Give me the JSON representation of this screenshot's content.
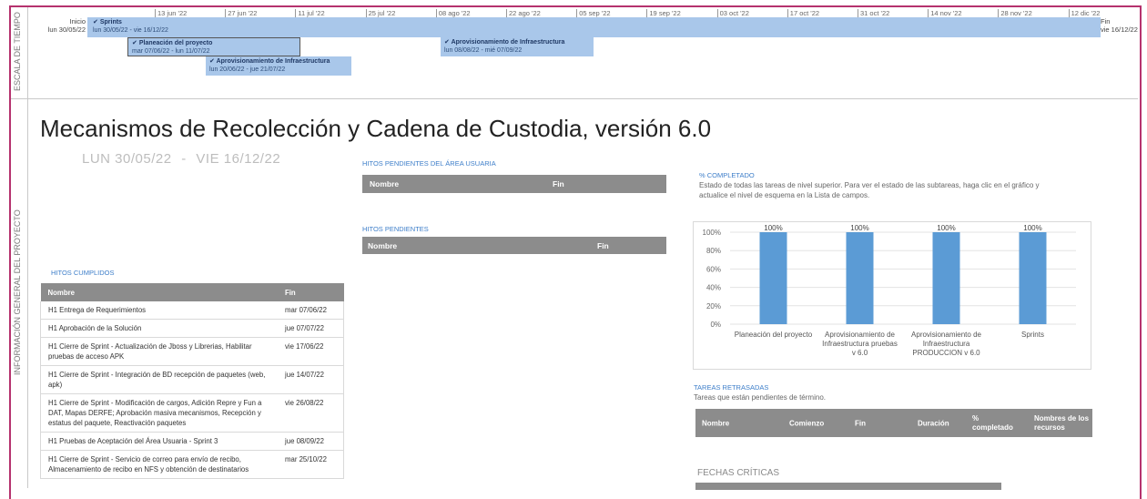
{
  "timeline": {
    "side_label": "ESCALA DE TIEMPO",
    "start": {
      "label": "Inicio",
      "date": "lun 30/05/22"
    },
    "end": {
      "label": "Fin",
      "date": "vie 16/12/22"
    },
    "ticks": [
      "13 jun '22",
      "27 jun '22",
      "11 jul '22",
      "25 jul '22",
      "08 ago '22",
      "22 ago '22",
      "05 sep '22",
      "19 sep '22",
      "03 oct '22",
      "17 oct '22",
      "31 oct '22",
      "14 nov '22",
      "28 nov '22",
      "12 dic '22"
    ],
    "tasks": [
      {
        "name": "Sprints",
        "dates": "lun 30/05/22 - vie 16/12/22"
      },
      {
        "name": "Planeación del proyecto",
        "dates": "mar 07/06/22 - lun 11/07/22"
      },
      {
        "name": "Aprovisionamiento de Infraestructura",
        "dates": "lun 08/08/22 - mié 07/09/22"
      },
      {
        "name": "Aprovisionamiento de Infraestructura",
        "dates": "lun 20/06/22 - jue 21/07/22"
      }
    ]
  },
  "project": {
    "side_label": "INFORMACIÓN GENERAL DEL PROYECTO",
    "title": "Mecanismos de Recolección y Cadena de Custodia, versión 6.0",
    "start": "LUN 30/05/22",
    "separator": "-",
    "end": "VIE 16/12/22"
  },
  "hitos_cumplidos": {
    "heading": "HITOS CUMPLIDOS",
    "col_nombre": "Nombre",
    "col_fin": "Fin",
    "rows": [
      {
        "nombre": "H1 Entrega de Requerimientos",
        "fin": "mar 07/06/22"
      },
      {
        "nombre": "H1 Aprobación de la Solución",
        "fin": "jue 07/07/22"
      },
      {
        "nombre": "H1 Cierre de Sprint - Actualización de Jboss y Librerias, Habilitar pruebas de acceso APK",
        "fin": "vie 17/06/22"
      },
      {
        "nombre": "H1 Cierre de Sprint - Integración de BD recepción de paquetes (web, apk)",
        "fin": "jue 14/07/22"
      },
      {
        "nombre": "H1 Cierre de Sprint - Modificación de cargos, Adición Repre y Fun a DAT, Mapas DERFE; Aprobación masiva mecanismos, Recepción y estatus del paquete, Reactivación paquetes",
        "fin": "vie 26/08/22"
      },
      {
        "nombre": "H1 Pruebas de Aceptación del Área Usuaria - Sprint 3",
        "fin": "jue 08/09/22"
      },
      {
        "nombre": "H1 Cierre de Sprint - Servicio de correo para envío de recibo, Almacenamiento de recibo en NFS y obtención de destinatarios",
        "fin": "mar 25/10/22"
      }
    ]
  },
  "hitos_usuaria": {
    "heading": "HITOS PENDIENTES DEL ÁREA USUARIA",
    "col_nombre": "Nombre",
    "col_fin": "Fin"
  },
  "hitos_pendientes": {
    "heading": "HITOS PENDIENTES",
    "col_nombre": "Nombre",
    "col_fin": "Fin"
  },
  "completado": {
    "heading": "% COMPLETADO",
    "note": "Estado de todas las tareas de nivel superior. Para ver el estado de las subtareas, haga clic en el gráfico y actualice el nivel de esquema en la Lista de campos."
  },
  "chart_data": {
    "type": "bar",
    "categories": [
      [
        "Planeación del proyecto"
      ],
      [
        "Aprovisionamiento de",
        "Infraestructura pruebas",
        "v 6.0"
      ],
      [
        "Aprovisionamiento de",
        "Infraestructura",
        "PRODUCCION v 6.0"
      ],
      [
        "Sprints"
      ]
    ],
    "values": [
      100,
      100,
      100,
      100
    ],
    "data_labels": [
      "100%",
      "100%",
      "100%",
      "100%"
    ],
    "ylim": [
      0,
      100
    ],
    "yticks": [
      "0%",
      "20%",
      "40%",
      "60%",
      "80%",
      "100%"
    ],
    "bar_color": "#5b9bd5",
    "grid": true
  },
  "tareas_retrasadas": {
    "heading": "TAREAS RETRASADAS",
    "note": "Tareas que están pendientes de término.",
    "cols": [
      "Nombre",
      "Comienzo",
      "Fin",
      "Duración",
      "% completado",
      "Nombres de los recursos"
    ]
  },
  "fechas_criticas": {
    "heading": "FECHAS CRÍTICAS"
  }
}
